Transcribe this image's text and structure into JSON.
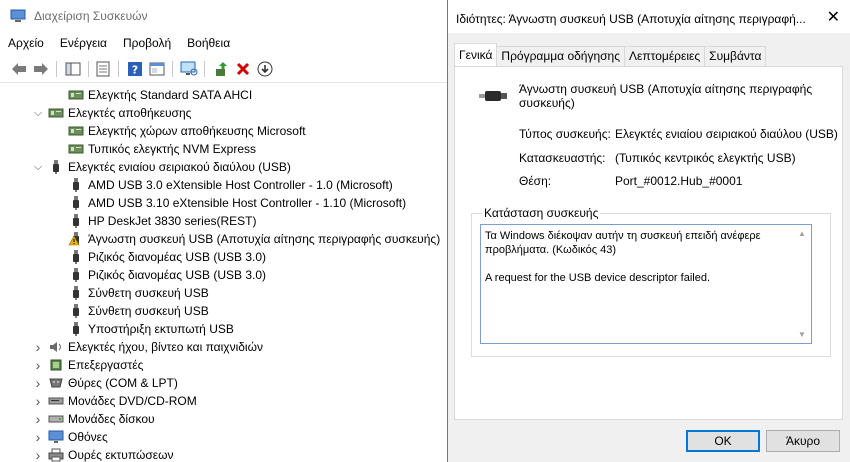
{
  "main": {
    "title": "Διαχείριση Συσκευών",
    "menu": [
      "Αρχείο",
      "Ενέργεια",
      "Προβολή",
      "Βοήθεια"
    ],
    "tree": [
      {
        "label": "Ελεγκτής Standard SATA AHCI",
        "level": 2,
        "icon": "storage-controller-icon"
      },
      {
        "label": "Ελεγκτές αποθήκευσης",
        "level": 1,
        "expanded": true,
        "icon": "storage-controller-icon"
      },
      {
        "label": "Ελεγκτής χώρων αποθήκευσης Microsoft",
        "level": 2,
        "icon": "storage-controller-icon"
      },
      {
        "label": "Τυπικός ελεγκτής NVM Express",
        "level": 2,
        "icon": "storage-controller-icon"
      },
      {
        "label": "Ελεγκτές ενιαίου σειριακού διαύλου (USB)",
        "level": 1,
        "expanded": true,
        "icon": "usb-icon"
      },
      {
        "label": "AMD USB 3.0 eXtensible Host Controller - 1.0 (Microsoft)",
        "level": 2,
        "icon": "usb-icon"
      },
      {
        "label": "AMD USB 3.10 eXtensible Host Controller - 1.10 (Microsoft)",
        "level": 2,
        "icon": "usb-icon"
      },
      {
        "label": "HP DeskJet 3830 series(REST)",
        "level": 2,
        "icon": "usb-icon"
      },
      {
        "label": "Άγνωστη συσκευή USB (Αποτυχία αίτησης περιγραφής συσκευής)",
        "level": 2,
        "icon": "warning-icon"
      },
      {
        "label": "Ριζικός διανομέας USB (USB 3.0)",
        "level": 2,
        "icon": "usb-icon"
      },
      {
        "label": "Ριζικός διανομέας USB (USB 3.0)",
        "level": 2,
        "icon": "usb-icon"
      },
      {
        "label": "Σύνθετη συσκευή USB",
        "level": 2,
        "icon": "usb-icon"
      },
      {
        "label": "Σύνθετη συσκευή USB",
        "level": 2,
        "icon": "usb-icon"
      },
      {
        "label": "Υποστήριξη εκτυπωτή USB",
        "level": 2,
        "icon": "usb-icon"
      },
      {
        "label": "Ελεγκτές ήχου, βίντεο και παιχνιδιών",
        "level": 1,
        "expanded": false,
        "icon": "speaker-icon"
      },
      {
        "label": "Επεξεργαστές",
        "level": 1,
        "expanded": false,
        "icon": "cpu-icon"
      },
      {
        "label": "Θύρες (COM & LPT)",
        "level": 1,
        "expanded": false,
        "icon": "port-icon"
      },
      {
        "label": "Μονάδες DVD/CD-ROM",
        "level": 1,
        "expanded": false,
        "icon": "dvd-icon"
      },
      {
        "label": "Μονάδες δίσκου",
        "level": 1,
        "expanded": false,
        "icon": "disk-icon"
      },
      {
        "label": "Οθόνες",
        "level": 1,
        "expanded": false,
        "icon": "monitor-icon"
      },
      {
        "label": "Ουρές εκτυπώσεων",
        "level": 1,
        "expanded": false,
        "icon": "printer-icon"
      }
    ]
  },
  "dialog": {
    "title": "Ιδιότητες: Άγνωστη συσκευή USB (Αποτυχία αίτησης περιγραφή...",
    "close": "✕",
    "tabs": [
      "Γενικά",
      "Πρόγραμμα οδήγησης",
      "Λεπτομέρειες",
      "Συμβάντα"
    ],
    "active_tab": 0,
    "device_name": "Άγνωστη συσκευή USB (Αποτυχία αίτησης περιγραφής συσκευής)",
    "properties": {
      "type_label": "Τύπος συσκευής:",
      "type_value": "Ελεγκτές ενιαίου σειριακού διαύλου (USB)",
      "manufacturer_label": "Κατασκευαστής:",
      "manufacturer_value": "(Τυπικός κεντρικός ελεγκτής USB)",
      "location_label": "Θέση:",
      "location_value": "Port_#0012.Hub_#0001"
    },
    "status_group_label": "Κατάσταση συσκευής",
    "status_text": "Τα Windows διέκοψαν αυτήν τη συσκευή επειδή ανέφερε προβλήματα. (Κωδικός 43)\n\nA request for the USB device descriptor failed.",
    "ok_label": "OK",
    "cancel_label": "Άκυρο"
  },
  "colors": {
    "warning": "#e8b400",
    "delete": "#d40000",
    "accent": "#0078d7"
  }
}
